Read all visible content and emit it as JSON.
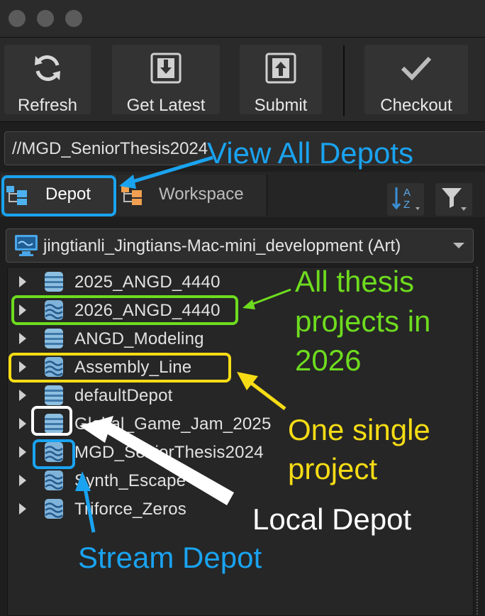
{
  "window": {
    "traffic_lights": [
      "close",
      "minimize",
      "zoom"
    ]
  },
  "toolbar": {
    "refresh_label": "Refresh",
    "get_latest_label": "Get Latest",
    "submit_label": "Submit",
    "checkout_label": "Checkout"
  },
  "path_field": {
    "value": "//MGD_SeniorThesis2024"
  },
  "tabs": {
    "depot_label": "Depot",
    "workspace_label": "Workspace"
  },
  "workspace_selector": {
    "value": "jingtianli_Jingtians-Mac-mini_development (Art)"
  },
  "depots": [
    {
      "name": "2025_ANGD_4440",
      "type": "local"
    },
    {
      "name": "2026_ANGD_4440",
      "type": "stream"
    },
    {
      "name": "ANGD_Modeling",
      "type": "local"
    },
    {
      "name": "Assembly_Line",
      "type": "stream"
    },
    {
      "name": "defaultDepot",
      "type": "local"
    },
    {
      "name": "Global_Game_Jam_2025",
      "type": "local"
    },
    {
      "name": "MGD_SeniorThesis2024",
      "type": "stream"
    },
    {
      "name": "Synth_Escape",
      "type": "stream"
    },
    {
      "name": "Triforce_Zeros",
      "type": "stream"
    }
  ],
  "annotations": {
    "view_all_depots": "View All Depots",
    "thesis_line1": "All thesis",
    "thesis_line2": "projects in",
    "thesis_line3": "2026",
    "single_line1": "One single",
    "single_line2": "project",
    "local_depot": "Local Depot",
    "stream_depot": "Stream Depot"
  },
  "colors": {
    "blue": "#1aa3f0",
    "green": "#6edc1e",
    "yellow": "#f5dc15",
    "white": "#ffffff",
    "accent_icon": "#4db2ef",
    "workspace_icon": "#f0a050"
  }
}
